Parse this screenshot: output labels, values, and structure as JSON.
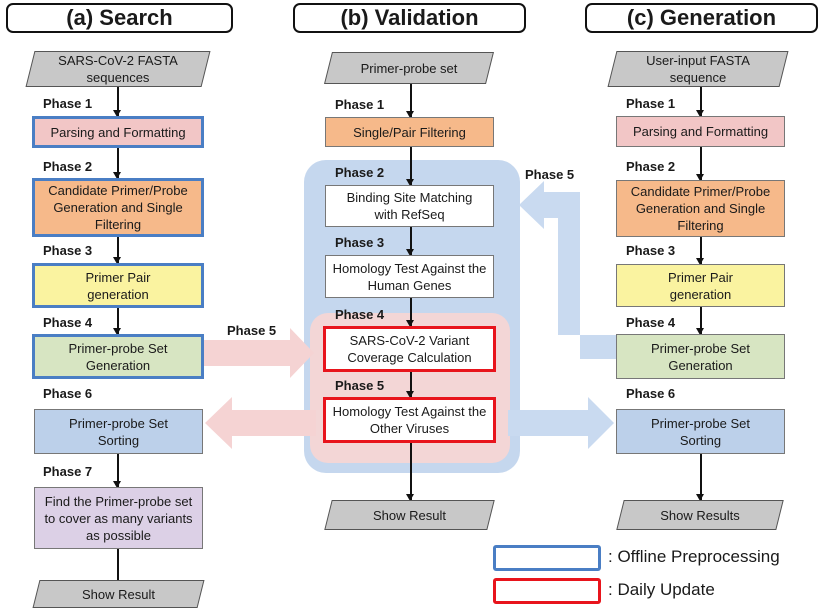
{
  "titles": {
    "search": "(a) Search",
    "validation": "(b) Validation",
    "generation": "(c) Generation"
  },
  "search": {
    "input": "SARS-CoV-2 FASTA sequences",
    "phases": [
      {
        "phase": "Phase 1",
        "label": "Parsing and Formatting",
        "color": "#f2c6c6",
        "border": "offline"
      },
      {
        "phase": "Phase 2",
        "label": "Candidate Primer/Probe Generation and Single Filtering",
        "color": "#f6b98a",
        "border": "offline"
      },
      {
        "phase": "Phase 3",
        "label": "Primer Pair generation",
        "color": "#faf3a0",
        "border": "offline"
      },
      {
        "phase": "Phase 4",
        "label": "Primer-probe Set Generation",
        "color": "#d7e5c2",
        "border": "offline"
      },
      {
        "phase": "Phase 6",
        "label": "Primer-probe Set Sorting",
        "color": "#bcd0ea",
        "border": "none"
      },
      {
        "phase": "Phase 7",
        "label": "Find the Primer-probe set to cover as many variants as possible",
        "color": "#dcd0e6",
        "border": "none"
      }
    ],
    "output": "Show Result"
  },
  "validation": {
    "input": "Primer-probe set",
    "phases": [
      {
        "phase": "Phase 1",
        "label": "Single/Pair Filtering",
        "color": "#f6b98a",
        "border": "none"
      },
      {
        "phase": "Phase 2",
        "label": "Binding Site Matching with RefSeq",
        "color": "#ffffff",
        "border": "none"
      },
      {
        "phase": "Phase 3",
        "label": "Homology Test Against the Human Genes",
        "color": "#ffffff",
        "border": "none"
      },
      {
        "phase": "Phase 4",
        "label": "SARS-CoV-2 Variant Coverage Calculation",
        "color": "#ffffff",
        "border": "daily"
      },
      {
        "phase": "Phase 5",
        "label": "Homology Test Against the Other Viruses",
        "color": "#ffffff",
        "border": "daily"
      }
    ],
    "output": "Show Result"
  },
  "generation": {
    "input": "User-input FASTA sequence",
    "phases": [
      {
        "phase": "Phase 1",
        "label": "Parsing and Formatting",
        "color": "#f2c6c6",
        "border": "none"
      },
      {
        "phase": "Phase 2",
        "label": "Candidate Primer/Probe Generation and Single Filtering",
        "color": "#f6b98a",
        "border": "none"
      },
      {
        "phase": "Phase 3",
        "label": "Primer Pair generation",
        "color": "#faf3a0",
        "border": "none"
      },
      {
        "phase": "Phase 4",
        "label": "Primer-probe Set Generation",
        "color": "#d7e5c2",
        "border": "none"
      },
      {
        "phase": "Phase 6",
        "label": "Primer-probe Set Sorting",
        "color": "#bcd0ea",
        "border": "none"
      }
    ],
    "output": "Show Results"
  },
  "connectors": {
    "search_to_validation": "Phase 5",
    "generation_to_validation": "Phase 5"
  },
  "legend": [
    {
      "label": ": Offline Preprocessing",
      "color": "#4a7ec4"
    },
    {
      "label": ": Daily Update",
      "color": "#e8141c"
    }
  ],
  "colors": {
    "offline_border": "#4a7ec4",
    "daily_border": "#e8141c",
    "validation_region_blue": "#c5d7ee",
    "validation_region_pink": "#f3d6d6",
    "pink_arrow": "#f5d3d3",
    "blue_arrow": "#c9daf0"
  }
}
